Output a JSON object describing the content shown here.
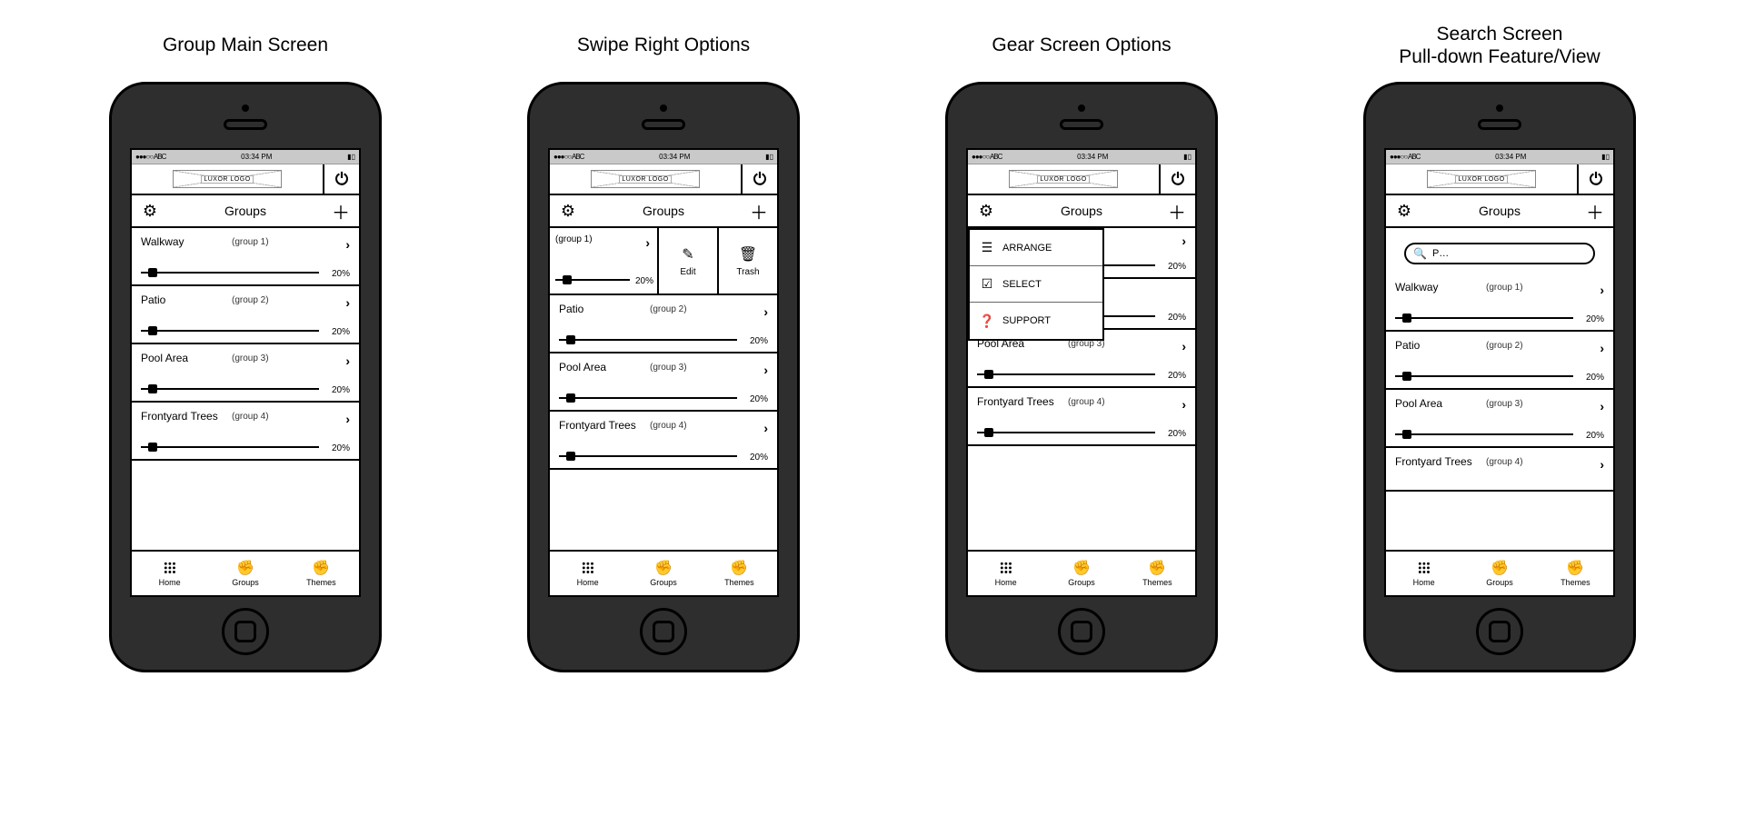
{
  "screens": {
    "s1": "Group Main Screen",
    "s2": "Swipe Right Options",
    "s3": "Gear Screen Options",
    "s4": "Search Screen\nPull-down Feature/View"
  },
  "status": {
    "carrier": "●●●○○ ABC",
    "time": "03:34 PM",
    "battery": "▮▯"
  },
  "logo_text": "LUXOR LOGO",
  "section": {
    "title": "Groups"
  },
  "groups": [
    {
      "name": "Walkway",
      "sub": "(group 1)",
      "pct": "20%"
    },
    {
      "name": "Patio",
      "sub": "(group 2)",
      "pct": "20%"
    },
    {
      "name": "Pool Area",
      "sub": "(group 3)",
      "pct": "20%"
    },
    {
      "name": "Frontyard Trees",
      "sub": "(group 4)",
      "pct": "20%"
    }
  ],
  "swipe": {
    "edit": "Edit",
    "trash": "Trash"
  },
  "gearmenu": [
    {
      "icon": "list",
      "label": "ARRANGE"
    },
    {
      "icon": "check",
      "label": "SELECT"
    },
    {
      "icon": "help",
      "label": "SUPPORT"
    }
  ],
  "search": {
    "query": "P…"
  },
  "tabs": {
    "home": "Home",
    "groups": "Groups",
    "themes": "Themes"
  }
}
